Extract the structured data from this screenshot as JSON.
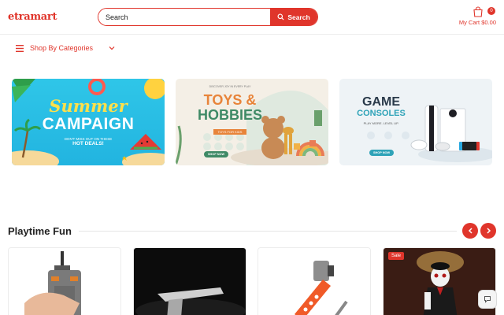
{
  "header": {
    "logo": "etramart",
    "search": {
      "placeholder": "Search",
      "button_label": "Search"
    },
    "cart": {
      "count": "0",
      "label": "My Cart $0.00"
    }
  },
  "categories": {
    "label": "Shop By Categories"
  },
  "banners": [
    {
      "title_1": "Summer",
      "title_2": "CAMPAIGN",
      "line_1": "DON'T MISS OUT ON THESE",
      "line_2": "HOT DEALS!"
    },
    {
      "tagline": "DISCOVER JOY IN EVERY PLAY",
      "title_1": "TOYS &",
      "title_2": "HOBBIES",
      "ribbon": "TOYS FOR KIDS",
      "button": "SHOP NOW"
    },
    {
      "title_1": "GAME",
      "title_2": "CONSOLES",
      "tagline": "PLAY MORE. LEVEL UP.",
      "button": "SHOP NOW"
    }
  ],
  "section": {
    "title": "Playtime Fun"
  },
  "products": [
    {
      "icon": "tool-clamp-image",
      "badge": ""
    },
    {
      "icon": "pistol-image",
      "badge": ""
    },
    {
      "icon": "orange-clamp-image",
      "badge": ""
    },
    {
      "icon": "puppet-doll-image",
      "badge": "Sale"
    }
  ],
  "colors": {
    "accent": "#e0352b"
  }
}
